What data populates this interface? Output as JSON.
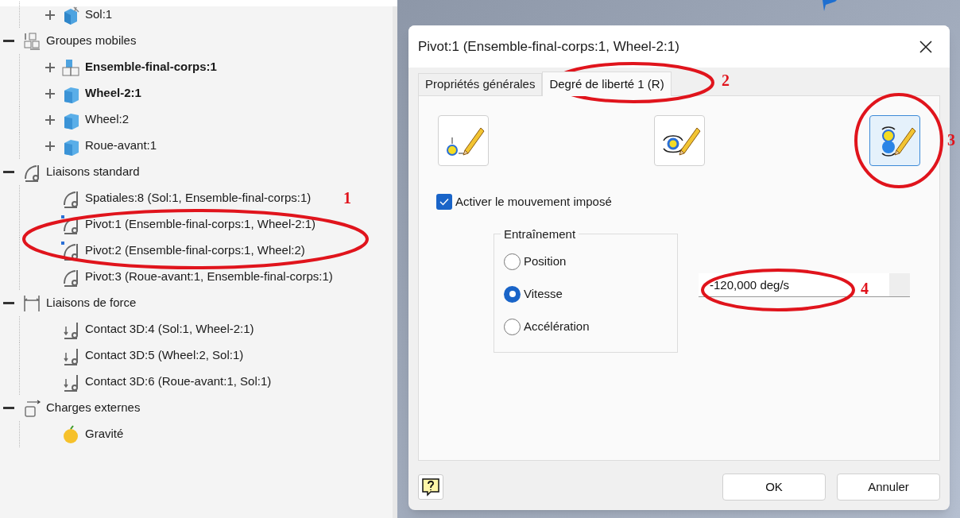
{
  "tree": {
    "continued_children": [
      {
        "label": "Sol:1",
        "kind": "ground",
        "bold": false,
        "expandable": true,
        "flagged": false
      }
    ],
    "groups": [
      {
        "label": "Groupes mobiles",
        "kind": "mobile-groups",
        "expanded": true,
        "children": [
          {
            "label": "Ensemble-final-corps:1",
            "kind": "assembly",
            "bold": true,
            "expandable": true,
            "flagged": false
          },
          {
            "label": "Wheel-2:1",
            "kind": "body",
            "bold": true,
            "expandable": true,
            "flagged": false
          },
          {
            "label": "Wheel:2",
            "kind": "body",
            "bold": false,
            "expandable": true,
            "flagged": false
          },
          {
            "label": "Roue-avant:1",
            "kind": "body",
            "bold": false,
            "expandable": true,
            "flagged": false
          }
        ]
      },
      {
        "label": "Liaisons standard",
        "kind": "joint",
        "expanded": true,
        "children": [
          {
            "label": "Spatiales:8 (Sol:1, Ensemble-final-corps:1)",
            "kind": "joint",
            "bold": false,
            "expandable": false,
            "flagged": false
          },
          {
            "label": "Pivot:1 (Ensemble-final-corps:1, Wheel-2:1)",
            "kind": "joint",
            "bold": false,
            "expandable": false,
            "flagged": true
          },
          {
            "label": "Pivot:2 (Ensemble-final-corps:1, Wheel:2)",
            "kind": "joint",
            "bold": false,
            "expandable": false,
            "flagged": true
          },
          {
            "label": "Pivot:3 (Roue-avant:1, Ensemble-final-corps:1)",
            "kind": "joint",
            "bold": false,
            "expandable": false,
            "flagged": false
          }
        ]
      },
      {
        "label": "Liaisons de force",
        "kind": "force",
        "expanded": true,
        "children": [
          {
            "label": "Contact 3D:4 (Sol:1, Wheel-2:1)",
            "kind": "contact",
            "bold": false,
            "expandable": false,
            "flagged": false
          },
          {
            "label": "Contact 3D:5 (Wheel:2, Sol:1)",
            "kind": "contact",
            "bold": false,
            "expandable": false,
            "flagged": false
          },
          {
            "label": "Contact 3D:6 (Roue-avant:1, Sol:1)",
            "kind": "contact",
            "bold": false,
            "expandable": false,
            "flagged": false
          }
        ]
      },
      {
        "label": "Charges externes",
        "kind": "load",
        "expanded": true,
        "children": [
          {
            "label": "Gravité",
            "kind": "gravity",
            "bold": false,
            "expandable": false,
            "flagged": false
          }
        ]
      }
    ]
  },
  "dialog": {
    "title": "Pivot:1 (Ensemble-final-corps:1, Wheel-2:1)",
    "tabs": [
      {
        "label": "Propriétés générales",
        "selected": false
      },
      {
        "label": "Degré de liberté 1 (R)",
        "selected": true
      }
    ],
    "motion_buttons": [
      {
        "kind": "locked",
        "selected": false
      },
      {
        "kind": "free",
        "selected": false
      },
      {
        "kind": "imposed",
        "selected": true
      }
    ],
    "checkbox": {
      "label": "Activer le mouvement imposé",
      "checked": true
    },
    "group": {
      "title": "Entraînement",
      "options": [
        {
          "label": "Position",
          "selected": false
        },
        {
          "label": "Vitesse",
          "selected": true
        },
        {
          "label": "Accélération",
          "selected": false
        }
      ]
    },
    "value": "-120,000 deg/s",
    "buttons": [
      "OK",
      "Annuler"
    ]
  },
  "annotations": [
    {
      "label": "1"
    },
    {
      "label": "2"
    },
    {
      "label": "3"
    },
    {
      "label": "4"
    }
  ]
}
